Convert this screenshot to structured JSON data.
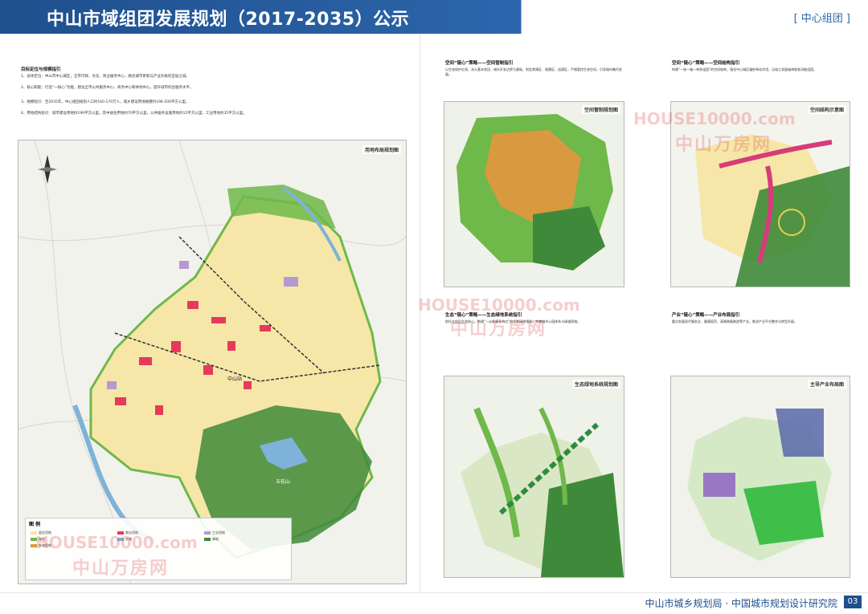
{
  "header": {
    "title": "中山市域组团发展规划（2017-2035）公示",
    "tag": "[ 中心组团 ]"
  },
  "left_section": {
    "section_heading": "目标定位与规模指引",
    "paragraphs": [
      "1、总体定位：中山市中心城区，全市行政、文化、商业服务中心，融合城市更新与产业升级的宜居之城。",
      "2、核心职能：打造“一核心”功能，建设全市公共服务中心、商务中心和休闲中心，提升城市综合服务水平。",
      "3、规模指引：至2035年，中心组团规划人口约160-170万人，城乡建设用地规模约196-200平方公里。",
      "4、用地结构指引：城市建设用地约196平方公里，其中居住用地约70平方公里，公共服务设施用地约15平方公里，工业用地约35平方公里。"
    ],
    "map_title": "用地布局规划图",
    "place_labels": [
      "中山站",
      "五桂山"
    ],
    "legend_title": "图 例"
  },
  "panels": [
    {
      "heading": "空间“链心”策略——空间管制指引",
      "map_title": "空间管制规划图",
      "text": "以生态保护红线、永久基本农田、城市开发边界为基础，划定禁建区、限建区、适建区，严格管控生态空间，引导城市集约发展。"
    },
    {
      "heading": "空间“链心”策略——空间结构指引",
      "map_title": "空间结构示意图",
      "text": "构建“一核一轴一带多组团”的空间结构，强化中心城区辐射带动作用，沿岐江发展轴串联各功能组团。"
    },
    {
      "heading": "生态“链心”策略——生态绿地系统指引",
      "map_title": "生态绿地系统规划图",
      "text": "依托五桂山生态核心，构建“一心多廊多节点”的生态绿地格局，完善城市公园体系与绿道网络。"
    },
    {
      "heading": "产业“链心”策略——产业布局指引",
      "map_title": "主导产业布局图",
      "text": "重点发展现代服务业、健康医药、高端装备制造等产业，推进产业平台整合与转型升级。"
    }
  ],
  "footer": {
    "text": "中山市城乡规划局 · 中国城市规划设计研究院",
    "page": "03"
  },
  "watermarks": {
    "en": "HOUSE10000.com",
    "cn": "中山万房网"
  },
  "colors": {
    "brand_blue": "#1f4f8d",
    "residential": "#f6e7a8",
    "commercial": "#e63a5c",
    "industrial": "#b49ad1",
    "green": "#6fb84a",
    "water": "#7fb2d8",
    "forest": "#3f8a3a",
    "agri": "#d99a3f"
  },
  "legend": [
    {
      "label": "居住用地",
      "color": "#f6e7a8"
    },
    {
      "label": "商业用地",
      "color": "#e63a5c"
    },
    {
      "label": "工业用地",
      "color": "#b49ad1"
    },
    {
      "label": "绿地",
      "color": "#6fb84a"
    },
    {
      "label": "水域",
      "color": "#7fb2d8"
    },
    {
      "label": "林地",
      "color": "#3f8a3a"
    },
    {
      "label": "农林用地",
      "color": "#d99a3f"
    }
  ]
}
